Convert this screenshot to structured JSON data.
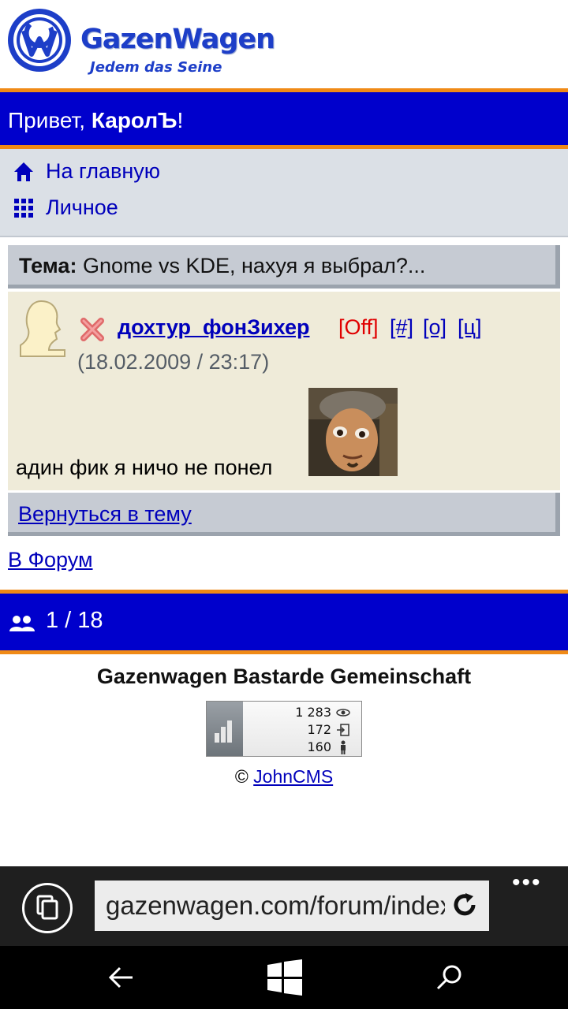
{
  "header": {
    "logo_name": "GazenWagen",
    "logo_slogan": "Jedem das Seine",
    "emblem_letters": "GW"
  },
  "greeting": {
    "prefix": "Привет, ",
    "user": "КаролЪ",
    "suffix": "!"
  },
  "menu": {
    "home": "На главную",
    "personal": "Личное"
  },
  "topic": {
    "label": "Тема:",
    "title": " Gnome vs KDE, нахуя я выбрал?..."
  },
  "post": {
    "author": "дохтур_фонЗихер",
    "status": "[Off]",
    "links": [
      "[#]",
      "[о]",
      "[ц]"
    ],
    "timestamp": "(18.02.2009 / 23:17)",
    "message": "адин фик я ничо не понел"
  },
  "nav": {
    "back_to_topic": "Вернуться в тему",
    "forum": "В Форум"
  },
  "online": {
    "count": "1 / 18"
  },
  "footer": {
    "site_name": "Gazenwagen Bastarde Gemeinschaft",
    "counter": [
      "1 283",
      "172",
      "160"
    ],
    "copyright_symbol": "© ",
    "copyright_link": "JohnCMS"
  },
  "browser": {
    "url": "gazenwagen.com/forum/index.php"
  },
  "colors": {
    "bar_blue": "#0000cc",
    "bar_orange": "#f08a16",
    "link_blue": "#0000bb",
    "status_red": "#e00000"
  }
}
